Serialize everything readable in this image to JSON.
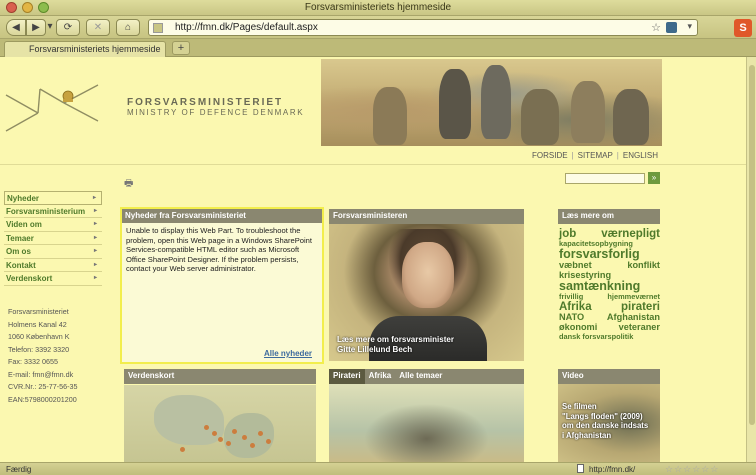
{
  "window": {
    "title": "Forsvarsministeriets hjemmeside"
  },
  "toolbar": {
    "back_icon": "◀",
    "forward_icon": "▶",
    "dropdown_icon": "▾",
    "reload_icon": "⟳",
    "stop_icon": "✕",
    "home_icon": "⌂",
    "url": "http://fmn.dk/Pages/default.aspx",
    "star_icon": "☆",
    "url_dropdown_icon": "▾",
    "extension_label": "S"
  },
  "tabs": [
    {
      "label": "Forsvarsministeriets hjemmeside"
    }
  ],
  "new_tab_label": "+",
  "brand": {
    "name_da": "FORSVARSMINISTERIET",
    "name_en": "MINISTRY OF DEFENCE DENMARK"
  },
  "toplinks": [
    "FORSIDE",
    "SITEMAP",
    "ENGLISH"
  ],
  "toplink_separator": "|",
  "search": {
    "go_label": "»"
  },
  "print_icon": "🖶",
  "leftnav": [
    {
      "label": "Nyheder"
    },
    {
      "label": "Forsvarsministerium"
    },
    {
      "label": "Viden om"
    },
    {
      "label": "Temaer"
    },
    {
      "label": "Om os"
    },
    {
      "label": "Kontakt"
    },
    {
      "label": "Verdenskort"
    }
  ],
  "nav_arrow": "▸",
  "address_lines": [
    "Forsvarsministeriet",
    "Holmens Kanal 42",
    "1060 København K",
    "Telefon: 3392 3320",
    "Fax: 3332 0655",
    "E-mail: fmn@fmn.dk",
    "CVR.Nr.: 25-77-56-35",
    "EAN:5798000201200"
  ],
  "news": {
    "heading": "Nyheder fra Forsvarsministeriet",
    "body": "Unable to display this Web Part. To troubleshoot the problem, open this Web page in a Windows SharePoint Services-compatible HTML editor such as Microsoft Office SharePoint Designer. If the problem persists, contact your Web server administrator.",
    "more_link": "Alle nyheder"
  },
  "minister": {
    "heading": "Forsvarsministeren",
    "caption_line1": "Læs mere om forsvarsminister",
    "caption_line2": "Gitte Lillelund Bech"
  },
  "read_more": {
    "heading": "Læs mere om",
    "tags": [
      {
        "a": "job",
        "b": "værnepligt",
        "size": "l"
      },
      {
        "a": "kapacitetsopbygning",
        "b": "",
        "size": "s"
      },
      {
        "a": "forsvarsforlig",
        "b": "",
        "size": "xl"
      },
      {
        "a": "væbnet",
        "b": "konflikt",
        "size": "m"
      },
      {
        "a": "krisestyring",
        "b": "",
        "size": "m"
      },
      {
        "a": "samtænkning",
        "b": "",
        "size": "xl"
      },
      {
        "a": "frivillig",
        "b": "hjemmeværnet",
        "size": "s"
      },
      {
        "a": "Afrika",
        "b": "pirateri",
        "size": "l"
      },
      {
        "a": "NATO",
        "b": "Afghanistan",
        "size": "m"
      },
      {
        "a": "økonomi",
        "b": "veteraner",
        "size": "m"
      },
      {
        "a": "dansk forsvarspolitik",
        "b": "",
        "size": "s"
      }
    ]
  },
  "verdenskort": {
    "heading": "Verdenskort"
  },
  "pirater": {
    "tabs": [
      "Pirateri",
      "Afrika",
      "Alle temaer"
    ]
  },
  "video": {
    "heading": "Video",
    "caption": [
      "Se filmen",
      "\"Langs floden\" (2009)",
      "om den danske indsats",
      "i Afghanistan"
    ]
  },
  "statusbar": {
    "left": "Færdig",
    "url": "http://fmn.dk/",
    "stars": "☆☆☆☆☆☆"
  },
  "colors": {
    "page_bg": "#fbf8b0",
    "link_green": "#4f7a2b",
    "panel_head": "#8a8770",
    "highlight": "#f2ee4c"
  }
}
